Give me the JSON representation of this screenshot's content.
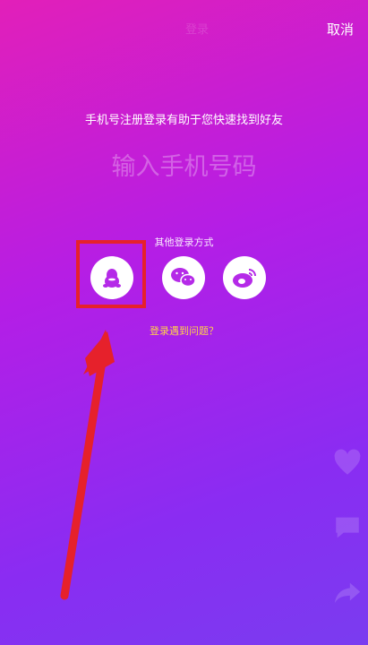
{
  "header": {
    "ghost_title": "登录",
    "cancel_label": "取消"
  },
  "main": {
    "subtitle": "手机号注册登录有助于您快速找到好友",
    "phone_placeholder": "输入手机号码"
  },
  "other_login": {
    "label": "其他登录方式",
    "options": [
      {
        "name": "QQ",
        "icon": "qq-penguin-icon"
      },
      {
        "name": "WeChat",
        "icon": "wechat-icon"
      },
      {
        "name": "Weibo",
        "icon": "weibo-icon"
      }
    ]
  },
  "problem_link": "登录遇到问题？",
  "colors": {
    "gradient_top": "#e21fb9",
    "gradient_bottom": "#7a3cf0",
    "link": "#ffd24a",
    "annotation": "#e6212b"
  }
}
